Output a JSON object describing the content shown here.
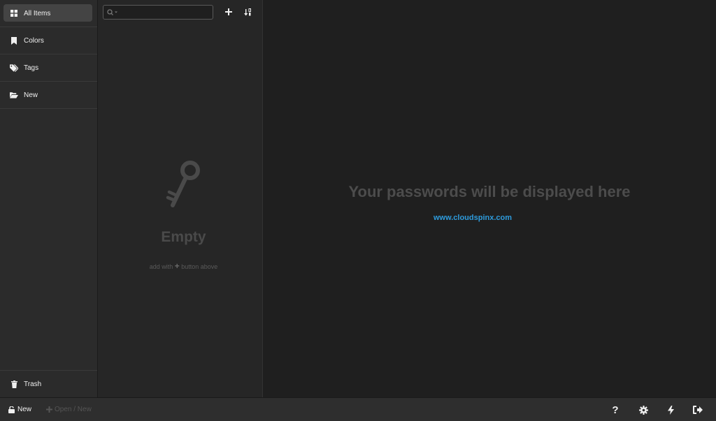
{
  "sidebar": {
    "items": [
      {
        "label": "All Items",
        "icon": "grid-icon",
        "active": true
      },
      {
        "label": "Colors",
        "icon": "bookmark-icon"
      },
      {
        "label": "Tags",
        "icon": "tags-icon"
      },
      {
        "label": "New",
        "icon": "folder-open-icon"
      }
    ],
    "trash": {
      "label": "Trash",
      "icon": "trash-icon"
    }
  },
  "list": {
    "search": {
      "placeholder": ""
    },
    "empty": {
      "title": "Empty",
      "hint_prefix": "add with",
      "hint_plus": "+",
      "hint_suffix": "button above"
    }
  },
  "detail": {
    "title": "Your passwords will be displayed here",
    "link": "www.cloudspinx.com"
  },
  "bottombar": {
    "new_label": "New",
    "open_label": "Open / New",
    "icons": [
      "help-icon",
      "gear-icon",
      "lightning-icon",
      "logout-icon"
    ]
  },
  "colors": {
    "link": "#2e9bdc",
    "background": "#1f1f1f",
    "sidebar": "#2b2b2b"
  }
}
